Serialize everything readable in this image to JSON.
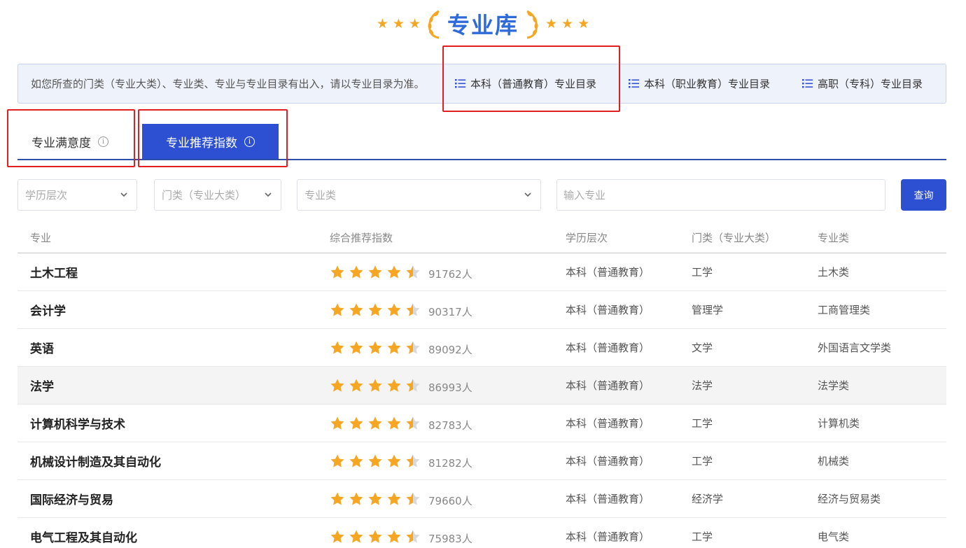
{
  "header": {
    "title": "专业库"
  },
  "notice": {
    "text": "如您所查的门类（专业大类）、专业类、专业与专业目录有出入，请以专业目录为准。",
    "links": [
      {
        "label": "本科（普通教育）专业目录"
      },
      {
        "label": "本科（职业教育）专业目录"
      },
      {
        "label": "高职（专科）专业目录"
      }
    ]
  },
  "tabs": {
    "satisfaction": "专业满意度",
    "recommend": "专业推荐指数",
    "info_glyph": "i"
  },
  "filters": {
    "level": "学历层次",
    "category": "门类（专业大类）",
    "subclass": "专业类",
    "search_placeholder": "输入专业",
    "query_button": "查询"
  },
  "table": {
    "headers": {
      "name": "专业",
      "rating": "综合推荐指数",
      "level": "学历层次",
      "category": "门类（专业大类）",
      "subclass": "专业类"
    },
    "rows": [
      {
        "name": "土木工程",
        "stars": 4.5,
        "count": "91762人",
        "level": "本科（普通教育）",
        "category": "工学",
        "subclass": "土木类"
      },
      {
        "name": "会计学",
        "stars": 4.5,
        "count": "90317人",
        "level": "本科（普通教育）",
        "category": "管理学",
        "subclass": "工商管理类"
      },
      {
        "name": "英语",
        "stars": 4.5,
        "count": "89092人",
        "level": "本科（普通教育）",
        "category": "文学",
        "subclass": "外国语言文学类"
      },
      {
        "name": "法学",
        "stars": 4.5,
        "count": "86993人",
        "level": "本科（普通教育）",
        "category": "法学",
        "subclass": "法学类"
      },
      {
        "name": "计算机科学与技术",
        "stars": 4.5,
        "count": "82783人",
        "level": "本科（普通教育）",
        "category": "工学",
        "subclass": "计算机类"
      },
      {
        "name": "机械设计制造及其自动化",
        "stars": 4.5,
        "count": "81282人",
        "level": "本科（普通教育）",
        "category": "工学",
        "subclass": "机械类"
      },
      {
        "name": "国际经济与贸易",
        "stars": 4.5,
        "count": "79660人",
        "level": "本科（普通教育）",
        "category": "经济学",
        "subclass": "经济与贸易类"
      },
      {
        "name": "电气工程及其自动化",
        "stars": 4.5,
        "count": "75983人",
        "level": "本科（普通教育）",
        "category": "工学",
        "subclass": "电气类"
      }
    ]
  },
  "colors": {
    "accent": "#2d50d3",
    "star": "#f5a623",
    "highlight_box": "#e02020"
  },
  "icons": [
    "star-icon",
    "laurel-icon",
    "list-icon",
    "info-icon",
    "chevron-down-icon"
  ]
}
